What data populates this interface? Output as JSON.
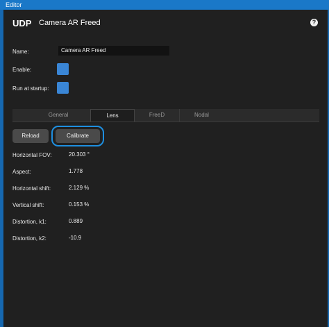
{
  "window": {
    "title": "Editor"
  },
  "header": {
    "brand": "UDP",
    "title": "Camera AR Freed",
    "help_icon": "?"
  },
  "form": {
    "name_label": "Name:",
    "name_value": "Camera AR Freed",
    "enable_label": "Enable:",
    "enable_checked": true,
    "startup_label": "Run at startup:",
    "startup_checked": true
  },
  "tabs": [
    {
      "label": "General",
      "active": false
    },
    {
      "label": "Lens",
      "active": true
    },
    {
      "label": "FreeD",
      "active": false
    },
    {
      "label": "Nodal",
      "active": false
    }
  ],
  "buttons": {
    "reload": "Reload",
    "calibrate": "Calibrate"
  },
  "lens": [
    {
      "label": "Horizontal FOV:",
      "value": "20.303 °"
    },
    {
      "label": "Aspect:",
      "value": "1.778"
    },
    {
      "label": "Horizontal shift:",
      "value": "2.129 %"
    },
    {
      "label": "Vertical shift:",
      "value": "0.153 %"
    },
    {
      "label": "Distortion, k1:",
      "value": "0.889"
    },
    {
      "label": "Distortion, k2:",
      "value": "-10.9"
    }
  ],
  "colors": {
    "accent": "#1a78c8",
    "checkbox": "#3a86d6",
    "focus_ring": "#1e8fe0"
  }
}
